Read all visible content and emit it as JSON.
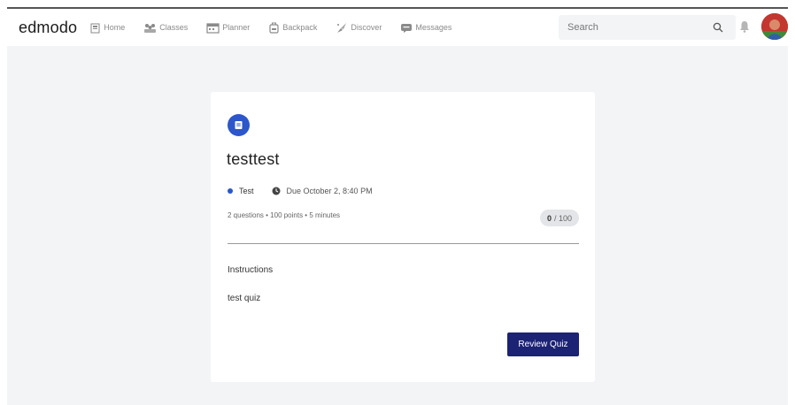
{
  "brand": {
    "logo": "edmodo"
  },
  "nav": {
    "items": [
      {
        "label": "Home",
        "icon": "home-icon"
      },
      {
        "label": "Classes",
        "icon": "classes-icon"
      },
      {
        "label": "Planner",
        "icon": "planner-icon"
      },
      {
        "label": "Backpack",
        "icon": "backpack-icon"
      },
      {
        "label": "Discover",
        "icon": "discover-icon"
      },
      {
        "label": "Messages",
        "icon": "messages-icon"
      }
    ],
    "search_placeholder": "Search"
  },
  "quiz": {
    "title": "testtest",
    "type": "Test",
    "due": "Due October 2, 8:40 PM",
    "stats": "2 questions • 100 points • 5 minutes",
    "score": "0",
    "score_total": "/ 100",
    "instructions_heading": "Instructions",
    "instructions_text": "test quiz",
    "review_button": "Review Quiz"
  },
  "colors": {
    "accent_blue": "#2c56c9",
    "button_navy": "#1c2274",
    "page_bg": "#f3f4f6"
  }
}
